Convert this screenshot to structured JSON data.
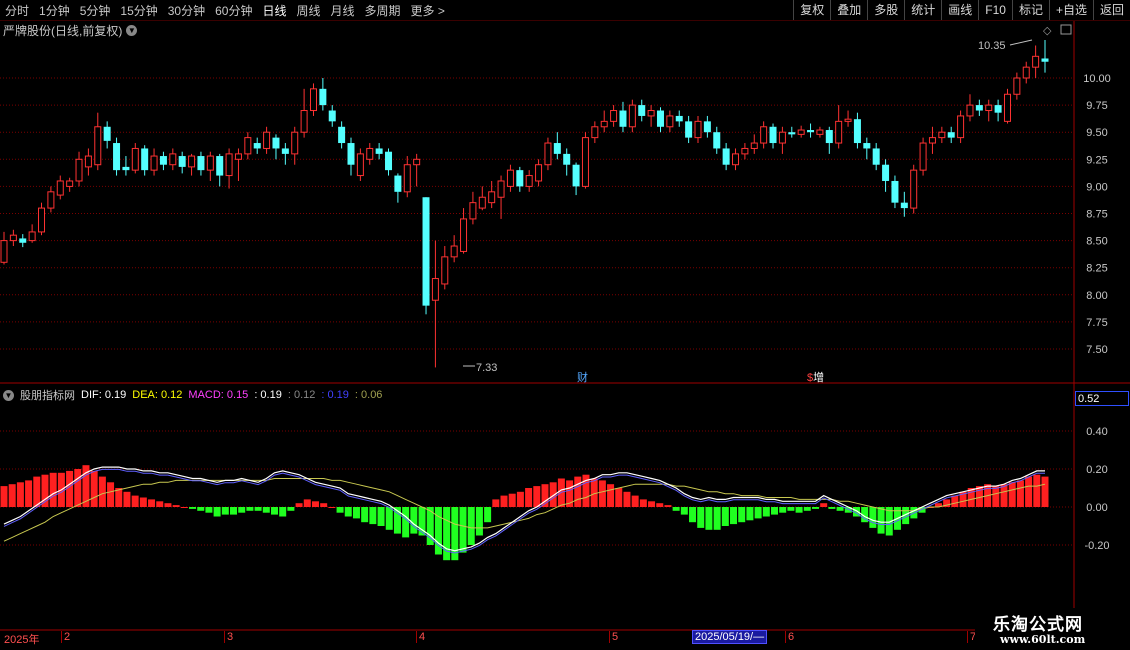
{
  "toolbar": {
    "periods": [
      "分时",
      "1分钟",
      "5分钟",
      "15分钟",
      "30分钟",
      "60分钟",
      "日线",
      "周线",
      "月线",
      "多周期",
      "更多 >"
    ],
    "active_period": "日线",
    "right_buttons": [
      "复权",
      "叠加",
      "多股",
      "统计",
      "画线",
      "F10",
      "标记",
      "+自选",
      "返回"
    ]
  },
  "main_chart": {
    "title": "严牌股份(日线,前复权)",
    "y_ticks": [
      "10.00",
      "9.75",
      "9.50",
      "9.25",
      "9.00",
      "8.75",
      "8.50",
      "8.25",
      "8.00",
      "7.75",
      "7.50"
    ],
    "high_label": "10.35",
    "low_label": "7.33",
    "event_markers": [
      "财",
      "增"
    ],
    "colors": {
      "up": "#ff3232",
      "down": "#54ffff",
      "grid": "#800000"
    }
  },
  "indicator": {
    "name": "股朋指标网",
    "dif_label": "DIF: 0.19",
    "dea_label": "DEA: 0.12",
    "macd_label": "MACD: 0.15",
    "extra_values": [
      ": 0.19",
      ": 0.12",
      ": 0.19",
      ": 0.06"
    ],
    "y_ticks": [
      "0.40",
      "0.20",
      "0.00",
      "-0.20"
    ],
    "cursor_value": "0.52",
    "colors": {
      "dif": "#ffffff",
      "dea": "#ffff00",
      "macd": "#ff00ff",
      "pos": "#ff2020",
      "neg": "#20ff20"
    }
  },
  "date_axis": {
    "year": "2025年",
    "months": [
      "2",
      "3",
      "4",
      "5",
      "6",
      "7"
    ],
    "highlighted_date": "2025/05/19/—"
  },
  "watermark": {
    "title": "乐淘公式网",
    "url": "www.60lt.com"
  },
  "chart_data": {
    "type": "candlestick",
    "price_ylim": [
      7.33,
      10.35
    ],
    "candles": [
      {
        "o": 8.3,
        "c": 8.5,
        "h": 8.58,
        "l": 8.28
      },
      {
        "o": 8.5,
        "c": 8.55,
        "h": 8.6,
        "l": 8.45
      },
      {
        "o": 8.52,
        "c": 8.48,
        "h": 8.56,
        "l": 8.44
      },
      {
        "o": 8.5,
        "c": 8.58,
        "h": 8.65,
        "l": 8.48
      },
      {
        "o": 8.58,
        "c": 8.8,
        "h": 8.85,
        "l": 8.55
      },
      {
        "o": 8.8,
        "c": 8.95,
        "h": 9.0,
        "l": 8.76
      },
      {
        "o": 8.92,
        "c": 9.05,
        "h": 9.1,
        "l": 8.88
      },
      {
        "o": 9.0,
        "c": 9.05,
        "h": 9.08,
        "l": 8.95
      },
      {
        "o": 9.05,
        "c": 9.25,
        "h": 9.32,
        "l": 9.0
      },
      {
        "o": 9.18,
        "c": 9.28,
        "h": 9.35,
        "l": 9.1
      },
      {
        "o": 9.2,
        "c": 9.55,
        "h": 9.68,
        "l": 9.15
      },
      {
        "o": 9.55,
        "c": 9.42,
        "h": 9.6,
        "l": 9.35
      },
      {
        "o": 9.4,
        "c": 9.15,
        "h": 9.45,
        "l": 9.1
      },
      {
        "o": 9.18,
        "c": 9.15,
        "h": 9.28,
        "l": 9.1
      },
      {
        "o": 9.15,
        "c": 9.35,
        "h": 9.4,
        "l": 9.12
      },
      {
        "o": 9.35,
        "c": 9.15,
        "h": 9.38,
        "l": 9.1
      },
      {
        "o": 9.15,
        "c": 9.28,
        "h": 9.35,
        "l": 9.1
      },
      {
        "o": 9.28,
        "c": 9.2,
        "h": 9.32,
        "l": 9.15
      },
      {
        "o": 9.2,
        "c": 9.3,
        "h": 9.35,
        "l": 9.15
      },
      {
        "o": 9.28,
        "c": 9.18,
        "h": 9.32,
        "l": 9.12
      },
      {
        "o": 9.18,
        "c": 9.28,
        "h": 9.3,
        "l": 9.1
      },
      {
        "o": 9.28,
        "c": 9.15,
        "h": 9.32,
        "l": 9.1
      },
      {
        "o": 9.15,
        "c": 9.28,
        "h": 9.32,
        "l": 9.05
      },
      {
        "o": 9.28,
        "c": 9.1,
        "h": 9.3,
        "l": 9.0
      },
      {
        "o": 9.1,
        "c": 9.3,
        "h": 9.35,
        "l": 8.98
      },
      {
        "o": 9.25,
        "c": 9.3,
        "h": 9.35,
        "l": 9.05
      },
      {
        "o": 9.3,
        "c": 9.45,
        "h": 9.5,
        "l": 9.25
      },
      {
        "o": 9.4,
        "c": 9.35,
        "h": 9.45,
        "l": 9.3
      },
      {
        "o": 9.35,
        "c": 9.5,
        "h": 9.55,
        "l": 9.3
      },
      {
        "o": 9.45,
        "c": 9.35,
        "h": 9.48,
        "l": 9.25
      },
      {
        "o": 9.35,
        "c": 9.3,
        "h": 9.4,
        "l": 9.2
      },
      {
        "o": 9.3,
        "c": 9.5,
        "h": 9.55,
        "l": 9.2
      },
      {
        "o": 9.5,
        "c": 9.7,
        "h": 9.9,
        "l": 9.45
      },
      {
        "o": 9.7,
        "c": 9.9,
        "h": 9.95,
        "l": 9.65
      },
      {
        "o": 9.9,
        "c": 9.75,
        "h": 10.0,
        "l": 9.7
      },
      {
        "o": 9.7,
        "c": 9.6,
        "h": 9.75,
        "l": 9.55
      },
      {
        "o": 9.55,
        "c": 9.4,
        "h": 9.6,
        "l": 9.35
      },
      {
        "o": 9.4,
        "c": 9.2,
        "h": 9.45,
        "l": 9.1
      },
      {
        "o": 9.1,
        "c": 9.3,
        "h": 9.35,
        "l": 9.05
      },
      {
        "o": 9.25,
        "c": 9.35,
        "h": 9.4,
        "l": 9.2
      },
      {
        "o": 9.35,
        "c": 9.3,
        "h": 9.4,
        "l": 9.25
      },
      {
        "o": 9.32,
        "c": 9.15,
        "h": 9.35,
        "l": 9.1
      },
      {
        "o": 9.1,
        "c": 8.95,
        "h": 9.12,
        "l": 8.85
      },
      {
        "o": 8.95,
        "c": 9.2,
        "h": 9.28,
        "l": 8.9
      },
      {
        "o": 9.2,
        "c": 9.25,
        "h": 9.3,
        "l": 9.0
      },
      {
        "o": 8.9,
        "c": 7.9,
        "h": 8.9,
        "l": 7.82
      },
      {
        "o": 7.95,
        "c": 8.15,
        "h": 8.5,
        "l": 7.33
      },
      {
        "o": 8.1,
        "c": 8.35,
        "h": 8.45,
        "l": 8.05
      },
      {
        "o": 8.35,
        "c": 8.45,
        "h": 8.55,
        "l": 8.3
      },
      {
        "o": 8.4,
        "c": 8.7,
        "h": 8.8,
        "l": 8.38
      },
      {
        "o": 8.7,
        "c": 8.85,
        "h": 8.95,
        "l": 8.65
      },
      {
        "o": 8.8,
        "c": 8.9,
        "h": 9.0,
        "l": 8.78
      },
      {
        "o": 8.85,
        "c": 8.95,
        "h": 9.05,
        "l": 8.8
      },
      {
        "o": 8.9,
        "c": 9.05,
        "h": 9.1,
        "l": 8.7
      },
      {
        "o": 9.0,
        "c": 9.15,
        "h": 9.2,
        "l": 8.95
      },
      {
        "o": 9.15,
        "c": 9.0,
        "h": 9.18,
        "l": 8.95
      },
      {
        "o": 9.0,
        "c": 9.1,
        "h": 9.15,
        "l": 8.95
      },
      {
        "o": 9.05,
        "c": 9.2,
        "h": 9.25,
        "l": 9.0
      },
      {
        "o": 9.2,
        "c": 9.4,
        "h": 9.45,
        "l": 9.15
      },
      {
        "o": 9.4,
        "c": 9.3,
        "h": 9.5,
        "l": 9.25
      },
      {
        "o": 9.3,
        "c": 9.2,
        "h": 9.35,
        "l": 9.1
      },
      {
        "o": 9.2,
        "c": 9.0,
        "h": 9.22,
        "l": 8.92
      },
      {
        "o": 9.0,
        "c": 9.45,
        "h": 9.5,
        "l": 8.98
      },
      {
        "o": 9.45,
        "c": 9.55,
        "h": 9.6,
        "l": 9.4
      },
      {
        "o": 9.55,
        "c": 9.6,
        "h": 9.7,
        "l": 9.5
      },
      {
        "o": 9.6,
        "c": 9.7,
        "h": 9.75,
        "l": 9.55
      },
      {
        "o": 9.7,
        "c": 9.55,
        "h": 9.78,
        "l": 9.5
      },
      {
        "o": 9.55,
        "c": 9.75,
        "h": 9.8,
        "l": 9.5
      },
      {
        "o": 9.75,
        "c": 9.65,
        "h": 9.8,
        "l": 9.6
      },
      {
        "o": 9.65,
        "c": 9.7,
        "h": 9.75,
        "l": 9.55
      },
      {
        "o": 9.7,
        "c": 9.55,
        "h": 9.73,
        "l": 9.5
      },
      {
        "o": 9.55,
        "c": 9.65,
        "h": 9.7,
        "l": 9.5
      },
      {
        "o": 9.65,
        "c": 9.6,
        "h": 9.7,
        "l": 9.55
      },
      {
        "o": 9.6,
        "c": 9.45,
        "h": 9.65,
        "l": 9.4
      },
      {
        "o": 9.45,
        "c": 9.6,
        "h": 9.65,
        "l": 9.4
      },
      {
        "o": 9.6,
        "c": 9.5,
        "h": 9.65,
        "l": 9.45
      },
      {
        "o": 9.5,
        "c": 9.35,
        "h": 9.55,
        "l": 9.3
      },
      {
        "o": 9.35,
        "c": 9.2,
        "h": 9.4,
        "l": 9.15
      },
      {
        "o": 9.2,
        "c": 9.3,
        "h": 9.35,
        "l": 9.15
      },
      {
        "o": 9.3,
        "c": 9.35,
        "h": 9.4,
        "l": 9.25
      },
      {
        "o": 9.35,
        "c": 9.4,
        "h": 9.48,
        "l": 9.3
      },
      {
        "o": 9.4,
        "c": 9.55,
        "h": 9.6,
        "l": 9.35
      },
      {
        "o": 9.55,
        "c": 9.4,
        "h": 9.58,
        "l": 9.35
      },
      {
        "o": 9.4,
        "c": 9.5,
        "h": 9.55,
        "l": 9.3
      },
      {
        "o": 9.5,
        "c": 9.48,
        "h": 9.55,
        "l": 9.45
      },
      {
        "o": 9.48,
        "c": 9.52,
        "h": 9.56,
        "l": 9.45
      },
      {
        "o": 9.52,
        "c": 9.5,
        "h": 9.58,
        "l": 9.45
      },
      {
        "o": 9.48,
        "c": 9.52,
        "h": 9.55,
        "l": 9.45
      },
      {
        "o": 9.52,
        "c": 9.4,
        "h": 9.55,
        "l": 9.3
      },
      {
        "o": 9.4,
        "c": 9.6,
        "h": 9.75,
        "l": 9.35
      },
      {
        "o": 9.6,
        "c": 9.62,
        "h": 9.7,
        "l": 9.55
      },
      {
        "o": 9.62,
        "c": 9.4,
        "h": 9.68,
        "l": 9.35
      },
      {
        "o": 9.4,
        "c": 9.35,
        "h": 9.45,
        "l": 9.25
      },
      {
        "o": 9.35,
        "c": 9.2,
        "h": 9.4,
        "l": 9.15
      },
      {
        "o": 9.2,
        "c": 9.05,
        "h": 9.25,
        "l": 8.95
      },
      {
        "o": 9.05,
        "c": 8.85,
        "h": 9.1,
        "l": 8.8
      },
      {
        "o": 8.85,
        "c": 8.8,
        "h": 8.95,
        "l": 8.72
      },
      {
        "o": 8.8,
        "c": 9.15,
        "h": 9.2,
        "l": 8.75
      },
      {
        "o": 9.15,
        "c": 9.4,
        "h": 9.45,
        "l": 9.1
      },
      {
        "o": 9.4,
        "c": 9.45,
        "h": 9.55,
        "l": 9.3
      },
      {
        "o": 9.45,
        "c": 9.5,
        "h": 9.55,
        "l": 9.4
      },
      {
        "o": 9.5,
        "c": 9.45,
        "h": 9.55,
        "l": 9.4
      },
      {
        "o": 9.45,
        "c": 9.65,
        "h": 9.7,
        "l": 9.4
      },
      {
        "o": 9.65,
        "c": 9.75,
        "h": 9.85,
        "l": 9.6
      },
      {
        "o": 9.75,
        "c": 9.7,
        "h": 9.8,
        "l": 9.65
      },
      {
        "o": 9.7,
        "c": 9.75,
        "h": 9.8,
        "l": 9.6
      },
      {
        "o": 9.75,
        "c": 9.68,
        "h": 9.8,
        "l": 9.6
      },
      {
        "o": 9.6,
        "c": 9.85,
        "h": 9.9,
        "l": 9.58
      },
      {
        "o": 9.85,
        "c": 10.0,
        "h": 10.05,
        "l": 9.8
      },
      {
        "o": 10.0,
        "c": 10.1,
        "h": 10.15,
        "l": 9.95
      },
      {
        "o": 10.1,
        "c": 10.2,
        "h": 10.3,
        "l": 10.0
      },
      {
        "o": 10.18,
        "c": 10.15,
        "h": 10.35,
        "l": 10.05
      }
    ],
    "macd_hist": [
      0.11,
      0.12,
      0.13,
      0.14,
      0.16,
      0.17,
      0.18,
      0.18,
      0.19,
      0.2,
      0.22,
      0.19,
      0.16,
      0.13,
      0.1,
      0.08,
      0.06,
      0.05,
      0.04,
      0.03,
      0.02,
      0.01,
      0.0,
      -0.01,
      -0.02,
      -0.03,
      -0.05,
      -0.04,
      -0.04,
      -0.03,
      -0.02,
      -0.02,
      -0.03,
      -0.04,
      -0.05,
      -0.02,
      0.02,
      0.04,
      0.03,
      0.02,
      0.0,
      -0.03,
      -0.05,
      -0.06,
      -0.08,
      -0.09,
      -0.1,
      -0.12,
      -0.14,
      -0.16,
      -0.14,
      -0.15,
      -0.2,
      -0.25,
      -0.28,
      -0.28,
      -0.24,
      -0.2,
      -0.15,
      -0.08,
      0.04,
      0.06,
      0.07,
      0.08,
      0.1,
      0.11,
      0.12,
      0.13,
      0.15,
      0.14,
      0.16,
      0.17,
      0.15,
      0.14,
      0.12,
      0.1,
      0.08,
      0.06,
      0.04,
      0.03,
      0.02,
      0.01,
      -0.02,
      -0.04,
      -0.08,
      -0.11,
      -0.12,
      -0.12,
      -0.1,
      -0.09,
      -0.08,
      -0.07,
      -0.06,
      -0.05,
      -0.04,
      -0.03,
      -0.02,
      -0.03,
      -0.02,
      -0.01,
      0.02,
      -0.01,
      -0.02,
      -0.03,
      -0.05,
      -0.08,
      -0.11,
      -0.14,
      -0.15,
      -0.12,
      -0.09,
      -0.06,
      -0.03,
      0.0,
      0.02,
      0.04,
      0.06,
      0.08,
      0.1,
      0.11,
      0.12,
      0.11,
      0.12,
      0.13,
      0.14,
      0.16,
      0.17,
      0.16
    ],
    "dif": [
      -0.09,
      -0.07,
      -0.05,
      -0.02,
      0.01,
      0.04,
      0.07,
      0.09,
      0.12,
      0.15,
      0.18,
      0.2,
      0.21,
      0.21,
      0.21,
      0.2,
      0.2,
      0.19,
      0.19,
      0.18,
      0.18,
      0.17,
      0.16,
      0.15,
      0.15,
      0.14,
      0.13,
      0.14,
      0.14,
      0.15,
      0.14,
      0.13,
      0.15,
      0.18,
      0.19,
      0.18,
      0.17,
      0.15,
      0.13,
      0.12,
      0.11,
      0.1,
      0.07,
      0.06,
      0.05,
      0.04,
      0.03,
      0.01,
      -0.02,
      -0.05,
      -0.09,
      -0.12,
      -0.15,
      -0.19,
      -0.22,
      -0.23,
      -0.22,
      -0.21,
      -0.19,
      -0.16,
      -0.14,
      -0.11,
      -0.08,
      -0.05,
      -0.02,
      0.0,
      0.03,
      0.06,
      0.09,
      0.1,
      0.12,
      0.14,
      0.15,
      0.17,
      0.17,
      0.18,
      0.18,
      0.17,
      0.16,
      0.15,
      0.14,
      0.12,
      0.1,
      0.07,
      0.05,
      0.04,
      0.05,
      0.04,
      0.04,
      0.05,
      0.05,
      0.05,
      0.05,
      0.04,
      0.04,
      0.03,
      0.03,
      0.03,
      0.03,
      0.03,
      0.06,
      0.04,
      0.02,
      0.0,
      -0.02,
      -0.05,
      -0.07,
      -0.08,
      -0.08,
      -0.06,
      -0.04,
      -0.02,
      0.0,
      0.02,
      0.04,
      0.06,
      0.07,
      0.08,
      0.09,
      0.1,
      0.11,
      0.11,
      0.12,
      0.14,
      0.15,
      0.17,
      0.19,
      0.19
    ],
    "dea": [
      -0.18,
      -0.16,
      -0.14,
      -0.12,
      -0.1,
      -0.08,
      -0.05,
      -0.03,
      -0.01,
      0.01,
      0.03,
      0.05,
      0.07,
      0.08,
      0.09,
      0.1,
      0.11,
      0.12,
      0.12,
      0.13,
      0.13,
      0.14,
      0.14,
      0.14,
      0.14,
      0.14,
      0.14,
      0.14,
      0.14,
      0.14,
      0.14,
      0.14,
      0.14,
      0.15,
      0.15,
      0.15,
      0.15,
      0.15,
      0.15,
      0.15,
      0.14,
      0.14,
      0.13,
      0.12,
      0.11,
      0.1,
      0.09,
      0.08,
      0.06,
      0.04,
      0.02,
      0.0,
      -0.02,
      -0.05,
      -0.07,
      -0.09,
      -0.1,
      -0.11,
      -0.11,
      -0.11,
      -0.1,
      -0.09,
      -0.08,
      -0.07,
      -0.06,
      -0.04,
      -0.03,
      -0.01,
      0.01,
      0.02,
      0.04,
      0.05,
      0.07,
      0.08,
      0.09,
      0.1,
      0.11,
      0.12,
      0.12,
      0.12,
      0.12,
      0.12,
      0.11,
      0.11,
      0.1,
      0.09,
      0.08,
      0.08,
      0.07,
      0.07,
      0.06,
      0.06,
      0.06,
      0.05,
      0.05,
      0.05,
      0.05,
      0.04,
      0.04,
      0.04,
      0.04,
      0.04,
      0.03,
      0.03,
      0.02,
      0.01,
      0.0,
      -0.01,
      -0.02,
      -0.02,
      -0.02,
      -0.02,
      -0.01,
      0.0,
      0.0,
      0.01,
      0.02,
      0.03,
      0.04,
      0.05,
      0.06,
      0.07,
      0.08,
      0.09,
      0.1,
      0.11,
      0.11,
      0.12
    ]
  }
}
